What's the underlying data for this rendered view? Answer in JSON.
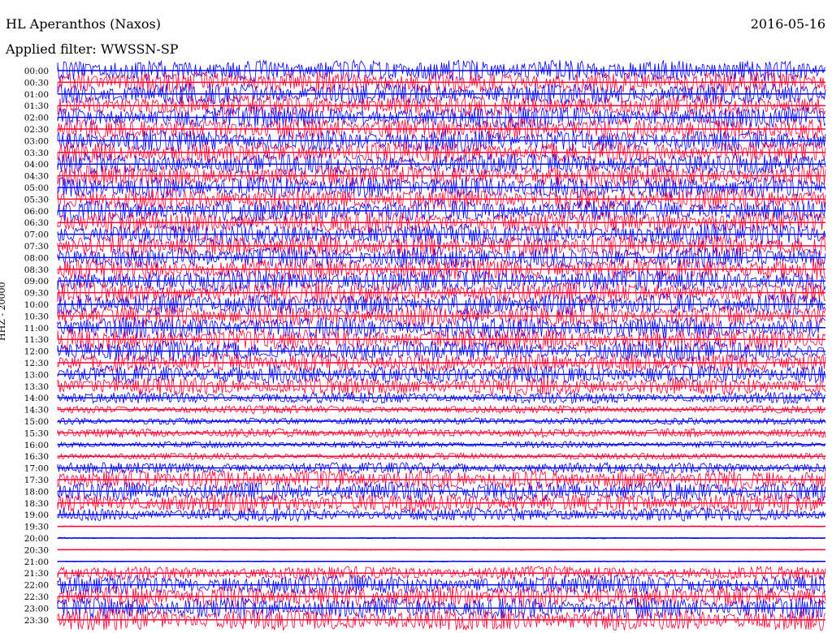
{
  "header": {
    "station": "HL Aperanthos (Naxos)",
    "date": "2016-05-16",
    "filter": "Applied filter: WWSSN-SP",
    "channel": "HHZ - 20000"
  },
  "chart_data": {
    "type": "line",
    "kind": "helicorder",
    "title": "HL Aperanthos (Naxos)",
    "date": "2016-05-16",
    "filter": "WWSSN-SP",
    "ylabel": "HHZ - 20000",
    "row_minutes": 30,
    "colors": {
      "even_row": "#0000ff",
      "odd_row": "#ff0033"
    },
    "rows": [
      {
        "time": "00:00",
        "amp": 0.95
      },
      {
        "time": "00:30",
        "amp": 0.95
      },
      {
        "time": "01:00",
        "amp": 0.95
      },
      {
        "time": "01:30",
        "amp": 0.95
      },
      {
        "time": "02:00",
        "amp": 0.95
      },
      {
        "time": "02:30",
        "amp": 0.95
      },
      {
        "time": "03:00",
        "amp": 0.95
      },
      {
        "time": "03:30",
        "amp": 0.95
      },
      {
        "time": "04:00",
        "amp": 0.95
      },
      {
        "time": "04:30",
        "amp": 0.95
      },
      {
        "time": "05:00",
        "amp": 0.95
      },
      {
        "time": "05:30",
        "amp": 0.95
      },
      {
        "time": "06:00",
        "amp": 0.95
      },
      {
        "time": "06:30",
        "amp": 0.95
      },
      {
        "time": "07:00",
        "amp": 0.95
      },
      {
        "time": "07:30",
        "amp": 0.95
      },
      {
        "time": "08:00",
        "amp": 0.95
      },
      {
        "time": "08:30",
        "amp": 0.95
      },
      {
        "time": "09:00",
        "amp": 0.95
      },
      {
        "time": "09:30",
        "amp": 0.95
      },
      {
        "time": "10:00",
        "amp": 0.95
      },
      {
        "time": "10:30",
        "amp": 0.95
      },
      {
        "time": "11:00",
        "amp": 0.95
      },
      {
        "time": "11:30",
        "amp": 0.95
      },
      {
        "time": "12:00",
        "amp": 0.9
      },
      {
        "time": "12:30",
        "amp": 0.85
      },
      {
        "time": "13:00",
        "amp": 0.8
      },
      {
        "time": "13:30",
        "amp": 0.8
      },
      {
        "time": "14:00",
        "amp": 0.5
      },
      {
        "time": "14:30",
        "amp": 0.35
      },
      {
        "time": "15:00",
        "amp": 0.3
      },
      {
        "time": "15:30",
        "amp": 0.4
      },
      {
        "time": "16:00",
        "amp": 0.3
      },
      {
        "time": "16:30",
        "amp": 0.3
      },
      {
        "time": "17:00",
        "amp": 0.5
      },
      {
        "time": "17:30",
        "amp": 0.85
      },
      {
        "time": "18:00",
        "amp": 0.85
      },
      {
        "time": "18:30",
        "amp": 0.85
      },
      {
        "time": "19:00",
        "amp": 0.6
      },
      {
        "time": "19:30",
        "amp": 0.05
      },
      {
        "time": "20:00",
        "amp": 0.06
      },
      {
        "time": "20:30",
        "amp": 0.04
      },
      {
        "time": "21:00",
        "amp": 0.05
      },
      {
        "time": "21:30",
        "amp": 0.6
      },
      {
        "time": "22:00",
        "amp": 0.9
      },
      {
        "time": "22:30",
        "amp": 0.95
      },
      {
        "time": "23:00",
        "amp": 0.95
      },
      {
        "time": "23:30",
        "amp": 0.95
      }
    ],
    "tick_labels": [
      "00:00",
      "00:30",
      "01:00",
      "01:30",
      "02:00",
      "02:30",
      "03:00",
      "03:30",
      "04:00",
      "04:30",
      "05:00",
      "05:30",
      "06:00",
      "06:30",
      "07:00",
      "07:30",
      "08:00",
      "08:30",
      "09:00",
      "09:30",
      "10:00",
      "10:30",
      "11:00",
      "11:30",
      "12:00",
      "12:30",
      "13:00",
      "13:30",
      "14:00",
      "14:30",
      "15:00",
      "15:30",
      "16:00",
      "16:30",
      "17:00",
      "17:30",
      "18:00",
      "18:30",
      "19:00",
      "19:30",
      "20:00",
      "20:30",
      "21:00",
      "21:30",
      "22:00",
      "22:30",
      "23:00",
      "23:30"
    ]
  }
}
